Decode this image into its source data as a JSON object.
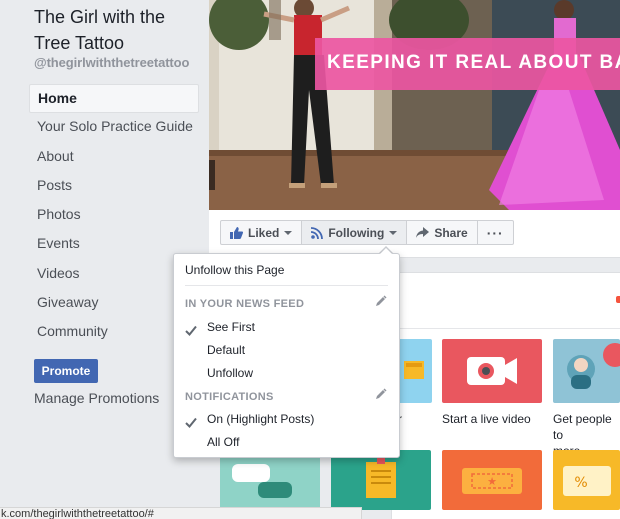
{
  "page": {
    "name": "The Girl with the Tree Tattoo",
    "handle": "@thegirlwiththetreetattoo"
  },
  "sidebar": {
    "items": [
      {
        "label": "Home",
        "active": true
      },
      {
        "label": "Your Solo Practice Guide"
      },
      {
        "label": "About"
      },
      {
        "label": "Posts"
      },
      {
        "label": "Photos"
      },
      {
        "label": "Events"
      },
      {
        "label": "Videos"
      },
      {
        "label": "Giveaway"
      },
      {
        "label": "Community"
      }
    ],
    "promote_label": "Promote",
    "manage_promotions_label": "Manage Promotions"
  },
  "cover": {
    "banner_text": "KEEPING IT REAL ABOUT BALLR"
  },
  "actions": {
    "liked_label": "Liked",
    "following_label": "Following",
    "share_label": "Share",
    "more_label": "···"
  },
  "dropdown": {
    "unfollow_page": "Unfollow this Page",
    "news_feed_header": "IN YOUR NEWS FEED",
    "see_first": "See First",
    "default": "Default",
    "unfollow": "Unfollow",
    "notifications_header": "NOTIFICATIONS",
    "on_highlight": "On (Highlight Posts)",
    "all_off": "All Off"
  },
  "tiles": {
    "live_video_label": "Start a live video",
    "get_people_label_line1": "Get people to",
    "get_people_label_line2": "more",
    "partial_label": "r"
  },
  "statusbar": {
    "url": "k.com/thegirlwiththetreetattoo/#"
  },
  "colors": {
    "facebook_blue": "#4267b2",
    "banner_pink": "#ec56a2",
    "live_tile_red": "#e9575f",
    "teal_tile": "#2ba38b",
    "orange_tile": "#f26b3a",
    "yellow_tile": "#f7b928"
  }
}
